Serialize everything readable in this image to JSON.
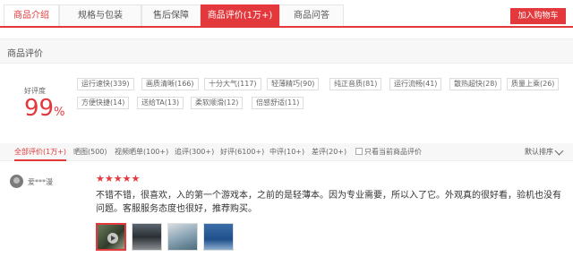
{
  "tabs": [
    {
      "label": "商品介绍"
    },
    {
      "label": "规格与包装"
    },
    {
      "label": "售后保障"
    },
    {
      "label": "商品评价(1万+)"
    },
    {
      "label": "商品问答"
    }
  ],
  "cart_button": "加入购物车",
  "section_title": "商品评价",
  "summary": {
    "rate_label": "好评度",
    "rate_value": "99",
    "rate_unit": "%"
  },
  "tags": [
    "运行速快(339)",
    "画质清晰(166)",
    "十分大气(117)",
    "轻薄精巧(90)",
    "纯正音质(81)",
    "运行流畅(41)",
    "散热超快(28)",
    "质量上乘(26)",
    "方便快捷(14)",
    "送给TA(13)",
    "柔软顺滑(12)",
    "倍感舒适(11)"
  ],
  "filters": [
    "全部评价(1万+)",
    "晒图(500)",
    "视频晒单(100+)",
    "追评(300+)",
    "好评(6100+)",
    "中评(10+)",
    "差评(20+)",
    "只看当前商品评价"
  ],
  "sort_label": "默认排序",
  "review": {
    "username": "爱***漫",
    "rating": 5,
    "text": "不错不错，很喜欢，入的第一个游戏本，之前的是轻薄本。因为专业需要，所以入了它。外观真的很好看，验机也没有问题。客服服务态度也很好，推荐购买。",
    "images": [
      "video-thumbnail",
      "photo-laptop-dark",
      "photo-laptop-box",
      "photo-laptop-screen"
    ]
  },
  "colors": {
    "accent": "#e4393c"
  }
}
